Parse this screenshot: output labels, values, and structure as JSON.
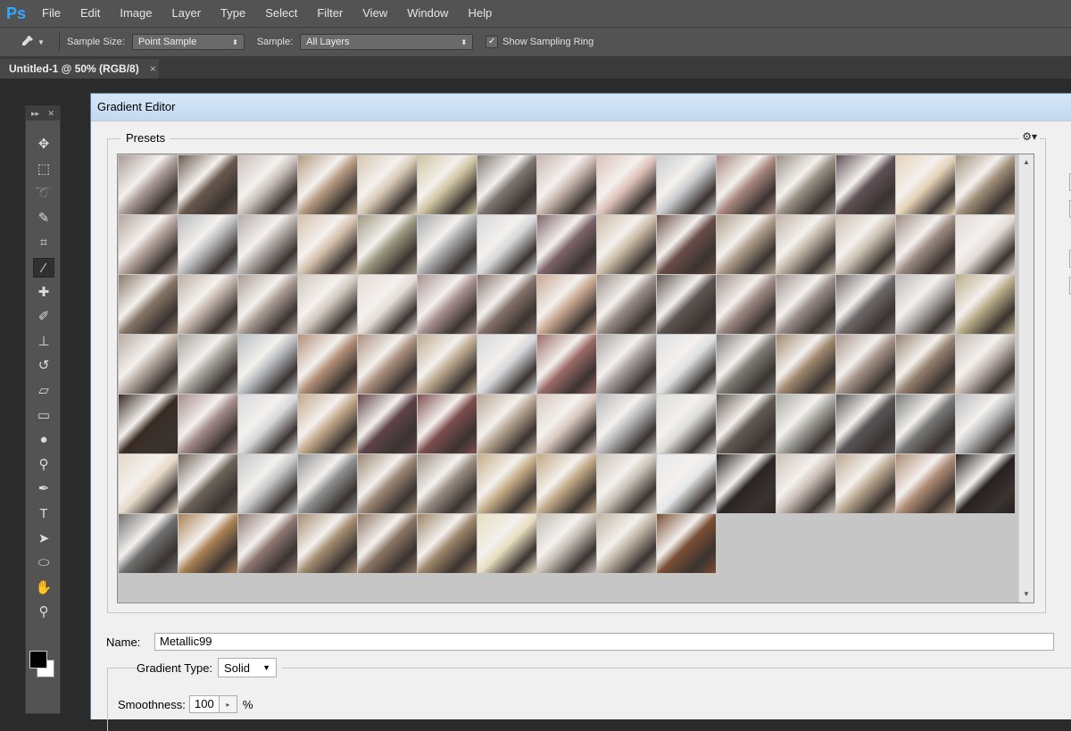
{
  "app": {
    "logo": "Ps"
  },
  "menu": [
    "File",
    "Edit",
    "Image",
    "Layer",
    "Type",
    "Select",
    "Filter",
    "View",
    "Window",
    "Help"
  ],
  "options": {
    "sample_size_label": "Sample Size:",
    "sample_size_value": "Point Sample",
    "sample_label": "Sample:",
    "sample_value": "All Layers",
    "show_ring_label": "Show Sampling Ring",
    "show_ring_checked": true
  },
  "document": {
    "tab_title": "Untitled-1 @ 50% (RGB/8)",
    "close": "×"
  },
  "tools": [
    "move-icon",
    "marquee-icon",
    "lasso-icon",
    "quick-select-icon",
    "crop-icon",
    "eyedropper-icon",
    "healing-brush-icon",
    "brush-icon",
    "stamp-icon",
    "history-brush-icon",
    "eraser-icon",
    "gradient-icon",
    "blur-icon",
    "dodge-icon",
    "pen-icon",
    "type-icon",
    "path-select-icon",
    "ellipse-icon",
    "hand-icon",
    "zoom-icon"
  ],
  "dialog": {
    "title": "Gradient Editor",
    "presets_label": "Presets",
    "name_label": "Name:",
    "name_value": "Metallic99",
    "gradient_type_label": "Gradient Type:",
    "gradient_type_value": "Solid",
    "smoothness_label": "Smoothness:",
    "smoothness_value": "100",
    "smoothness_unit": "%"
  },
  "swatch_palette": [
    "#a99a95",
    "#6a5a4f",
    "#c9bfb9",
    "#b59a80",
    "#d6c8b2",
    "#cfc4a0",
    "#7d7570",
    "#c8b5ad",
    "#dcc1b8",
    "#c8cbce",
    "#a9887f",
    "#9a9085",
    "#5f5055",
    "#e6d3b8",
    "#a3917c",
    "#b3a39a",
    "#b8b9bc",
    "#b3aca8",
    "#d4c0aa",
    "#9c9880",
    "#a7a8aa",
    "#d5d6d8",
    "#7c6468",
    "#c9b9a4",
    "#6a4d48",
    "#ad9c88",
    "#bfb2a4",
    "#cbbfb0",
    "#9d8b82",
    "#e2dad5",
    "#8a7869",
    "#bcaea4",
    "#aa9c94",
    "#d0c6be",
    "#e4dbd4",
    "#a89190",
    "#86726a",
    "#c8a890",
    "#9a8d87",
    "#5c5450",
    "#a08b86",
    "#9a8e8a",
    "#6f686a",
    "#b9b6b3",
    "#b9ad87",
    "#b6aaa0",
    "#a5a29b",
    "#b8bcc0",
    "#b28e78",
    "#aa8f7e",
    "#bca98f",
    "#d4d6d8",
    "#9b6a66",
    "#a7a0a0",
    "#dcdfe1",
    "#7d7b74",
    "#a08a70",
    "#a49287",
    "#968270",
    "#c3b8b0",
    "#3a2b24",
    "#a38b8a",
    "#d6d8da",
    "#c2a88a",
    "#5f4348",
    "#7d4e4e",
    "#b6a491",
    "#d7c6bd",
    "#b5b6b8",
    "#dcdcd9",
    "#625a53",
    "#a8a7a1",
    "#585656",
    "#797978",
    "#b7b9bb",
    "#e5d8c6",
    "#6c6258",
    "#c3c5c7",
    "#8e9090",
    "#998572",
    "#9b8f84",
    "#c6ad88",
    "#c0a884",
    "#c8c0b5",
    "#e4e6e8",
    "#2b2523",
    "#cbc0b7",
    "#bca890",
    "#ad8b74",
    "#26211f",
    "#6f6f6f",
    "#a98155",
    "#8e7772",
    "#a38d70",
    "#8e7665",
    "#9c8468",
    "#e7ddbf",
    "#c4bbb3",
    "#c0b4a5",
    "#794d34"
  ]
}
